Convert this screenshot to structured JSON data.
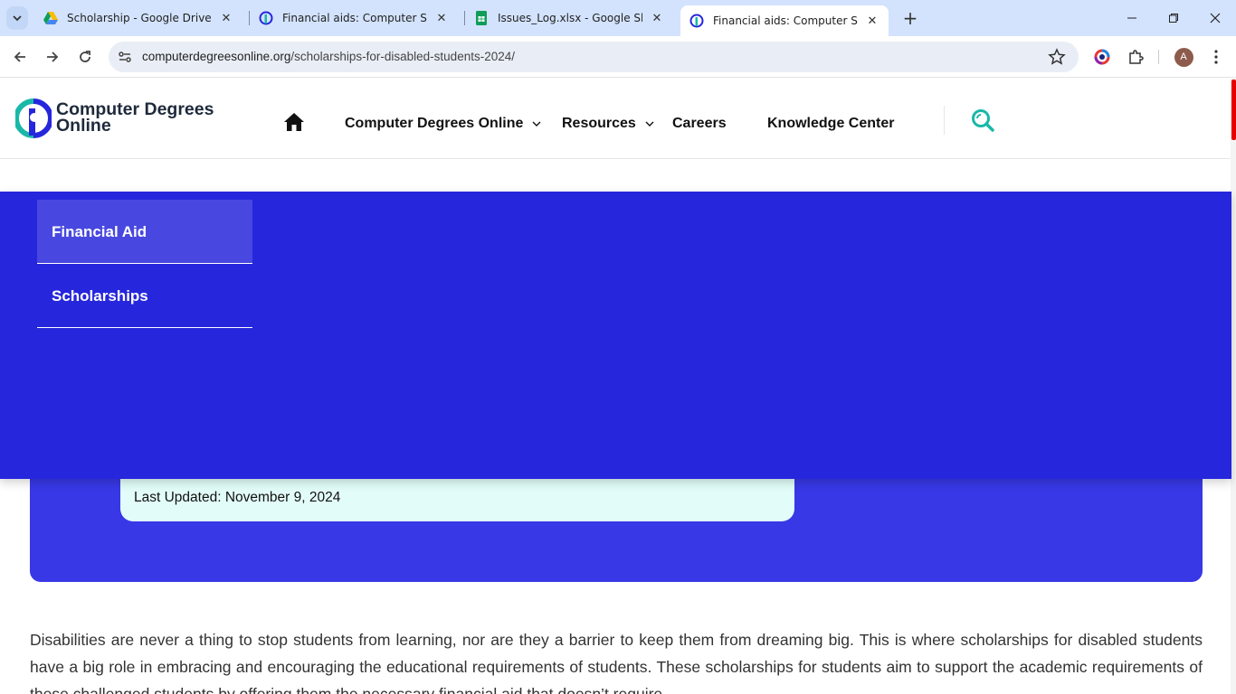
{
  "browser": {
    "tabs": [
      {
        "title": "Scholarship - Google Drive",
        "favicon": "google-drive-icon",
        "active": false
      },
      {
        "title": "Financial aids: Computer Scienc",
        "favicon": "cdo-site-icon",
        "active": false
      },
      {
        "title": "Issues_Log.xlsx - Google Sheets",
        "favicon": "google-sheets-icon",
        "active": false
      },
      {
        "title": "Financial aids: Computer Scienc",
        "favicon": "cdo-site-icon",
        "active": true
      }
    ],
    "url_host": "computerdegreesonline.org",
    "url_path": "/scholarships-for-disabled-students-2024/",
    "profile_initial": "A"
  },
  "site": {
    "logo_line1": "Computer Degrees",
    "logo_line2": "Online",
    "nav": {
      "degrees": "Computer Degrees Online",
      "resources": "Resources",
      "careers": "Careers",
      "knowledge": "Knowledge Center"
    },
    "dropdown": {
      "items": [
        {
          "label": "Financial Aid",
          "active": true
        },
        {
          "label": "Scholarships",
          "active": false
        }
      ]
    },
    "updated": "Last Updated: November 9, 2024",
    "intro": "Disabilities are never a thing to stop students from learning, nor are they a barrier to keep them from dreaming big. This is where scholarships for disabled students have a big role in embracing and encouraging the educational requirements of students. These scholarships for students  aim to support the academic requirements of these challenged students by offering them the necessary financial aid that doesn’t require"
  },
  "colors": {
    "brand_blue": "#2626dd",
    "hero_blue": "#3838e6",
    "accent_teal": "#19b8a8",
    "updated_bg": "#e2fdf9"
  }
}
